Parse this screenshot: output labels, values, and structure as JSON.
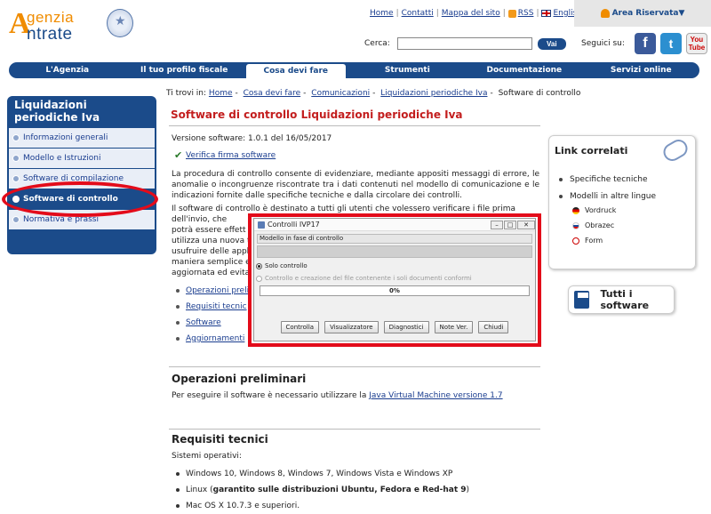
{
  "header": {
    "logo_word1": "genzia",
    "logo_word2": "ntrate",
    "logo_letter": "A",
    "top_links": [
      {
        "label": "Home"
      },
      {
        "label": "Contatti"
      },
      {
        "label": "Mappa del sito"
      },
      {
        "label": "RSS"
      },
      {
        "label": "English"
      }
    ],
    "area_riservata": "Area Riservata▼",
    "search_label": "Cerca:",
    "search_value": "",
    "search_button": "Vai",
    "social_label": "Seguici su:",
    "social": {
      "facebook": "f",
      "twitter": "t",
      "youtube_1": "You",
      "youtube_2": "Tube"
    }
  },
  "nav": {
    "items": [
      {
        "label": "L'Agenzia"
      },
      {
        "label": "Il tuo profilo fiscale"
      },
      {
        "label": "Cosa devi fare"
      },
      {
        "label": "Strumenti"
      },
      {
        "label": "Documentazione"
      },
      {
        "label": "Servizi online"
      }
    ]
  },
  "sidebar": {
    "title": "Liquidazioni periodiche Iva",
    "items": [
      {
        "label": "Informazioni generali"
      },
      {
        "label": "Modello e Istruzioni"
      },
      {
        "label": "Software di compilazione"
      },
      {
        "label": "Software di controllo"
      },
      {
        "label": "Normativa e prassi"
      }
    ]
  },
  "breadcrumb": {
    "prefix": "Ti trovi in:",
    "items": [
      "Home",
      "Cosa devi fare",
      "Comunicazioni",
      "Liquidazioni periodiche Iva",
      "Software di controllo"
    ]
  },
  "main": {
    "title": "Software di controllo Liquidazioni periodiche Iva",
    "version": "Versione software: 1.0.1 del 16/05/2017",
    "verify_link": "Verifica firma software",
    "para1": "La procedura di controllo consente di evidenziare, mediante appositi messaggi di errore, le anomalie o incongruenze riscontrate tra i dati contenuti nel modello di comunicazione e le indicazioni fornite dalle specifiche tecniche e dalla circolare dei controlli.",
    "para2_lines": [
      "Il software di controllo è destinato a tutti gli utenti che volessero verificare i file prima dell'invio, che",
      "potrà essere effett",
      "utilizza una nuova t",
      "usufruire delle appli",
      "maniera semplice e",
      "aggiornata ed evita"
    ],
    "links": [
      {
        "label": "Operazioni prelim"
      },
      {
        "label": "Requisiti tecnic"
      },
      {
        "label": "Software"
      },
      {
        "label": "Aggiornamenti"
      }
    ],
    "operazioni_title": "Operazioni preliminari",
    "operazioni_text": "Per eseguire il software è necessario utilizzare la",
    "operazioni_link": "Java Virtual Machine versione 1.7",
    "requisiti_title": "Requisiti tecnici",
    "sistemi_label": "Sistemi operativi:",
    "os_list": [
      {
        "text": "Windows 10, Windows 8, Windows 7, Windows Vista e Windows XP",
        "bold": ""
      },
      {
        "text": "Linux (",
        "bold": "garantito sulle distribuzioni Ubuntu, Fedora e Red-hat 9",
        "tail": ")"
      },
      {
        "text": "Mac OS X 10.7.3 e superiori.",
        "bold": ""
      }
    ]
  },
  "related": {
    "title": "Link correlati",
    "items": [
      {
        "label": "Specifiche tecniche"
      },
      {
        "label": "Modelli in altre lingue"
      }
    ],
    "languages": [
      {
        "label": "Vordruck"
      },
      {
        "label": "Obrazec"
      },
      {
        "label": "Form"
      }
    ]
  },
  "all_software": "Tutti i software",
  "dialog": {
    "title": "Controlli IVP17",
    "status": "Modello in fase di controllo",
    "radio1": "Solo controllo",
    "radio2": "Controllo e creazione del file contenente i soli documenti conformi",
    "progress": "0%",
    "buttons": [
      "Controlla",
      "Visualizzatore",
      "Diagnostici",
      "Note Ver.",
      "Chiudi"
    ]
  },
  "colors": {
    "brand": "#1b4b8a",
    "accent": "#f08c00",
    "title_red": "#c31e1e",
    "highlight": "#e30b1a"
  }
}
